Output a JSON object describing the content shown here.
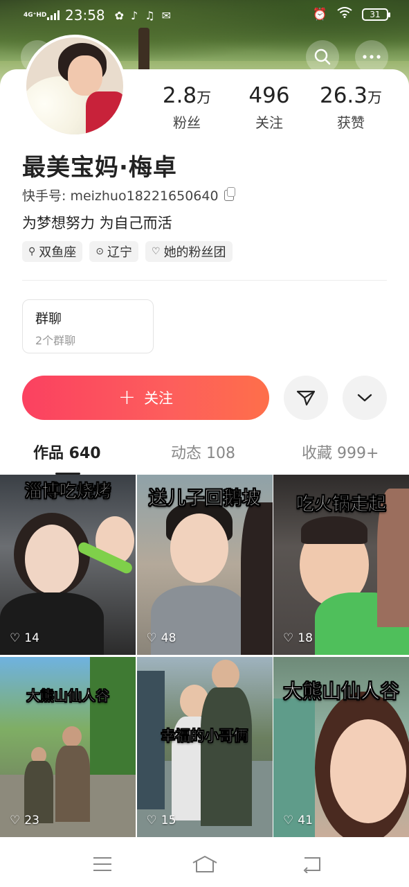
{
  "status_bar": {
    "network": "4G⁺HD",
    "time": "23:58",
    "battery": "31"
  },
  "profile": {
    "stats": [
      {
        "number": "2.8",
        "unit": "万",
        "label": "粉丝"
      },
      {
        "number": "496",
        "unit": "",
        "label": "关注"
      },
      {
        "number": "26.3",
        "unit": "万",
        "label": "获赞"
      }
    ],
    "nickname": "最美宝妈·梅卓",
    "kuaishou_id": "快手号: meizhuo18221650640",
    "signature": "为梦想努力 为自己而活",
    "tags": [
      {
        "icon": "zodiac-icon",
        "label": "双鱼座"
      },
      {
        "icon": "location-icon",
        "label": "辽宁"
      },
      {
        "icon": "fan-club-icon",
        "label": "她的粉丝团"
      }
    ]
  },
  "group_chat": {
    "title": "群聊",
    "subtitle": "2个群聊"
  },
  "actions": {
    "follow_label": "关注",
    "follow_color": "#fb4160"
  },
  "tabs": [
    {
      "label": "作品 640",
      "active": true
    },
    {
      "label": "动态 108",
      "active": false
    },
    {
      "label": "收藏 999+",
      "active": false
    }
  ],
  "videos": [
    {
      "caption": "淄博吃烧烤",
      "likes": "14"
    },
    {
      "caption": "送儿子回鹅坡",
      "likes": "48"
    },
    {
      "caption": "吃火锅走起",
      "likes": "18"
    },
    {
      "caption": "大熊山仙人谷",
      "likes": "23"
    },
    {
      "caption": "幸福的小哥俩",
      "likes": "15"
    },
    {
      "caption": "大熊山仙人谷",
      "likes": "41"
    }
  ]
}
